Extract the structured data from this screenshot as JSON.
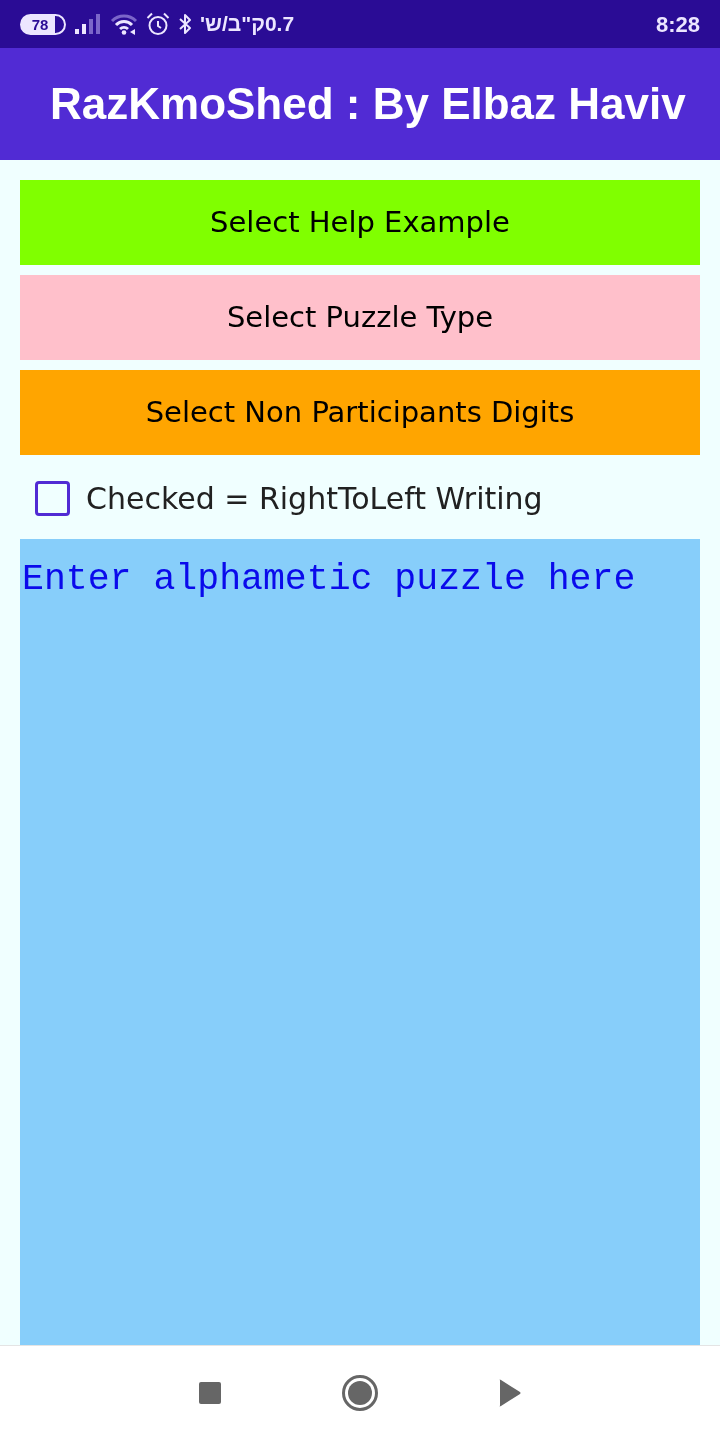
{
  "status_bar": {
    "battery": "78",
    "network_speed": "0.7ק\"ב/ש'",
    "time": "8:28"
  },
  "app_bar": {
    "title": "RazKmoShed : By Elbaz Haviv"
  },
  "buttons": [
    {
      "label": "Select Help Example",
      "color": "#80ff00"
    },
    {
      "label": "Select Puzzle Type",
      "color": "#ffc0cb"
    },
    {
      "label": "Select Non Participants Digits",
      "color": "#ffa500"
    }
  ],
  "rtl_checkbox": {
    "label": "Checked = RightToLeft Writing",
    "checked": false
  },
  "puzzle_input": {
    "placeholder": "Enter alphametic puzzle here"
  }
}
